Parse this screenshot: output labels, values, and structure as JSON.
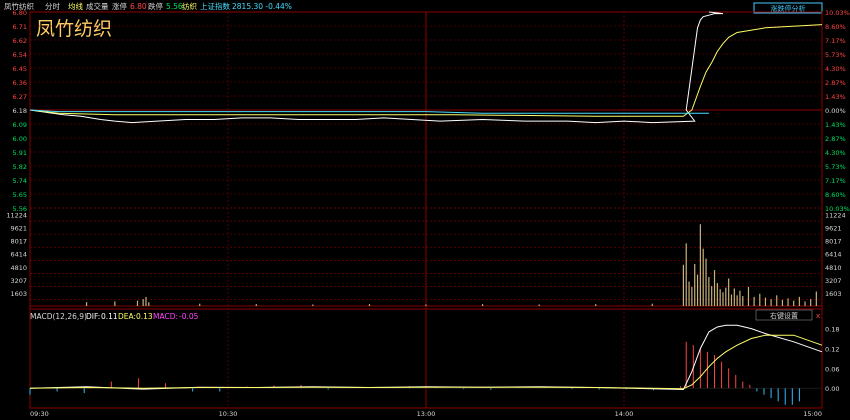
{
  "header": {
    "stock_name": "凤竹纺织",
    "view": "分时",
    "avg_label": "均线",
    "vol_label": "成交量",
    "up_limit_label": "涨停",
    "up_limit_value": "6.80",
    "down_limit_label": "跌停",
    "down_limit_value": "5.56",
    "industry": "纺织",
    "index_label": "上证指数",
    "index_value": "2815.30 -0.44%",
    "watermark": "凤竹纺织"
  },
  "buttons": {
    "limit_analysis": "涨跌停分析",
    "right_settings": "右键设置",
    "close_x": "x"
  },
  "macd": {
    "title": "MACD(12,26,9)",
    "dif_label": "DIF:",
    "dif_value": "0.11",
    "dea_label": "DEA:",
    "dea_value": "0.13",
    "macd_label": "MACD:",
    "macd_value": "-0.05"
  },
  "colors": {
    "up": "#ff4444",
    "down": "#00e060",
    "neutral": "#d8d8d8",
    "grid": "#8b0000",
    "price": "#ffffff",
    "avg": "#ffff66",
    "index": "#44ddff",
    "volume": "#c8b27a",
    "macd_pos": "#ff4444",
    "macd_neg": "#33bbff",
    "dif": "#ffffff",
    "dea": "#ffff66"
  },
  "chart_data": {
    "type": "line",
    "prev_close": 6.18,
    "price_axis": {
      "ticks": [
        "6.80",
        "6.71",
        "6.62",
        "6.54",
        "6.45",
        "6.36",
        "6.27",
        "6.18",
        "6.09",
        "6.00",
        "5.91",
        "5.82",
        "5.74",
        "5.65",
        "5.56"
      ],
      "min": 5.56,
      "max": 6.8
    },
    "pct_axis": {
      "ticks": [
        "10.03%",
        "8.60%",
        "7.17%",
        "5.73%",
        "4.30%",
        "2.87%",
        "1.43%",
        "0.00%",
        "1.43%",
        "2.87%",
        "4.30%",
        "5.73%",
        "7.17%",
        "8.60%",
        "10.03%"
      ]
    },
    "time_axis": [
      "09:30",
      "10:30",
      "13:00",
      "14:00",
      "15:00"
    ],
    "series": [
      {
        "name": "price",
        "x": [
          0,
          4,
          8,
          12,
          18,
          25,
          30,
          36,
          45,
          55,
          65,
          75,
          85,
          95,
          105,
          115,
          125,
          135,
          145,
          160,
          175,
          190,
          200,
          210,
          220,
          235,
          232,
          236,
          237,
          238,
          240,
          242,
          245,
          240
        ],
        "y": [
          6.18,
          6.17,
          6.16,
          6.15,
          6.14,
          6.12,
          6.11,
          6.1,
          6.11,
          6.12,
          6.12,
          6.13,
          6.13,
          6.12,
          6.12,
          6.12,
          6.13,
          6.12,
          6.11,
          6.12,
          6.11,
          6.11,
          6.1,
          6.11,
          6.1,
          6.11,
          6.18,
          6.7,
          6.75,
          6.77,
          6.78,
          6.79,
          6.79,
          6.8
        ]
      },
      {
        "name": "average",
        "x": [
          0,
          10,
          30,
          60,
          100,
          150,
          200,
          231,
          234,
          237,
          239,
          241,
          243,
          245,
          247,
          250,
          260,
          280
        ],
        "y": [
          6.18,
          6.16,
          6.15,
          6.15,
          6.15,
          6.15,
          6.14,
          6.14,
          6.18,
          6.33,
          6.42,
          6.48,
          6.55,
          6.6,
          6.64,
          6.67,
          6.7,
          6.72
        ]
      },
      {
        "name": "index",
        "x": [
          0,
          10,
          20,
          40,
          60,
          80,
          100,
          120,
          140,
          160,
          180,
          200,
          220,
          240
        ],
        "y": [
          6.18,
          6.17,
          6.17,
          6.17,
          6.17,
          6.17,
          6.17,
          6.17,
          6.17,
          6.16,
          6.16,
          6.16,
          6.16,
          6.16
        ]
      }
    ],
    "volume": {
      "ticks": [
        "11224",
        "9621",
        "8017",
        "6414",
        "4810",
        "3207",
        "1603"
      ],
      "max": 12827,
      "bars": [
        {
          "x": 20,
          "v": 500
        },
        {
          "x": 30,
          "v": 600
        },
        {
          "x": 38,
          "v": 700
        },
        {
          "x": 40,
          "v": 900
        },
        {
          "x": 41,
          "v": 1200
        },
        {
          "x": 42,
          "v": 500
        },
        {
          "x": 60,
          "v": 300
        },
        {
          "x": 80,
          "v": 250
        },
        {
          "x": 100,
          "v": 200
        },
        {
          "x": 120,
          "v": 250
        },
        {
          "x": 140,
          "v": 200
        },
        {
          "x": 160,
          "v": 250
        },
        {
          "x": 180,
          "v": 200
        },
        {
          "x": 200,
          "v": 250
        },
        {
          "x": 220,
          "v": 300
        },
        {
          "x": 231,
          "v": 5400
        },
        {
          "x": 232,
          "v": 8200
        },
        {
          "x": 233,
          "v": 3200
        },
        {
          "x": 234,
          "v": 2500
        },
        {
          "x": 235,
          "v": 5500
        },
        {
          "x": 236,
          "v": 4100
        },
        {
          "x": 237,
          "v": 10700
        },
        {
          "x": 238,
          "v": 7500
        },
        {
          "x": 239,
          "v": 6200
        },
        {
          "x": 240,
          "v": 3800
        },
        {
          "x": 241,
          "v": 2600
        },
        {
          "x": 242,
          "v": 4700
        },
        {
          "x": 243,
          "v": 3000
        },
        {
          "x": 244,
          "v": 2200
        },
        {
          "x": 245,
          "v": 1800
        },
        {
          "x": 246,
          "v": 2400
        },
        {
          "x": 247,
          "v": 3600
        },
        {
          "x": 248,
          "v": 1500
        },
        {
          "x": 249,
          "v": 2300
        },
        {
          "x": 250,
          "v": 1400
        },
        {
          "x": 251,
          "v": 2000
        },
        {
          "x": 252,
          "v": 1300
        },
        {
          "x": 254,
          "v": 2500
        },
        {
          "x": 256,
          "v": 1200
        },
        {
          "x": 258,
          "v": 1600
        },
        {
          "x": 260,
          "v": 1100
        },
        {
          "x": 262,
          "v": 900
        },
        {
          "x": 264,
          "v": 1400
        },
        {
          "x": 266,
          "v": 800
        },
        {
          "x": 268,
          "v": 1000
        },
        {
          "x": 270,
          "v": 700
        },
        {
          "x": 272,
          "v": 1200
        },
        {
          "x": 274,
          "v": 600
        },
        {
          "x": 276,
          "v": 900
        },
        {
          "x": 278,
          "v": 1900
        }
      ]
    },
    "macd_axis": {
      "ticks": [
        "0.18",
        "0.12",
        "0.06",
        "0.00"
      ],
      "min": -0.06,
      "max": 0.2
    },
    "macd_series": [
      {
        "name": "DIF",
        "x": [
          0,
          20,
          40,
          60,
          80,
          100,
          120,
          140,
          160,
          180,
          200,
          220,
          231,
          234,
          237,
          240,
          243,
          246,
          250,
          255,
          260,
          270,
          280
        ],
        "y": [
          0,
          0.004,
          -0.003,
          0.003,
          0.002,
          0.004,
          0.002,
          0.004,
          0.003,
          0.004,
          0.002,
          -0.002,
          -0.004,
          0.05,
          0.12,
          0.17,
          0.185,
          0.19,
          0.19,
          0.18,
          0.165,
          0.14,
          0.11
        ]
      },
      {
        "name": "DEA",
        "x": [
          0,
          20,
          40,
          60,
          80,
          100,
          120,
          140,
          160,
          180,
          200,
          220,
          231,
          234,
          237,
          240,
          243,
          246,
          250,
          255,
          260,
          270,
          280
        ],
        "y": [
          0,
          0.002,
          0.0,
          0.002,
          0.002,
          0.003,
          0.002,
          0.003,
          0.003,
          0.003,
          0.002,
          0.0,
          -0.002,
          0.01,
          0.035,
          0.065,
          0.09,
          0.11,
          0.13,
          0.15,
          0.16,
          0.16,
          0.13
        ]
      }
    ],
    "macd_hist": [
      -0.02,
      -0.01,
      -0.015,
      0.02,
      0.03,
      0.015,
      -0.01,
      -0.01,
      0.005,
      0.008,
      0.01,
      -0.004,
      0.003,
      0.004,
      0.006,
      0.004,
      -0.003,
      -0.005,
      0.004,
      0.004,
      -0.003,
      -0.004,
      -0.003,
      -0.006,
      0.006,
      0.14,
      0.13,
      0.12,
      0.11,
      0.1,
      0.08,
      0.06,
      0.04,
      0.02,
      0.01,
      -0.01,
      -0.02,
      -0.03,
      -0.04,
      -0.05,
      -0.05,
      -0.04
    ]
  }
}
